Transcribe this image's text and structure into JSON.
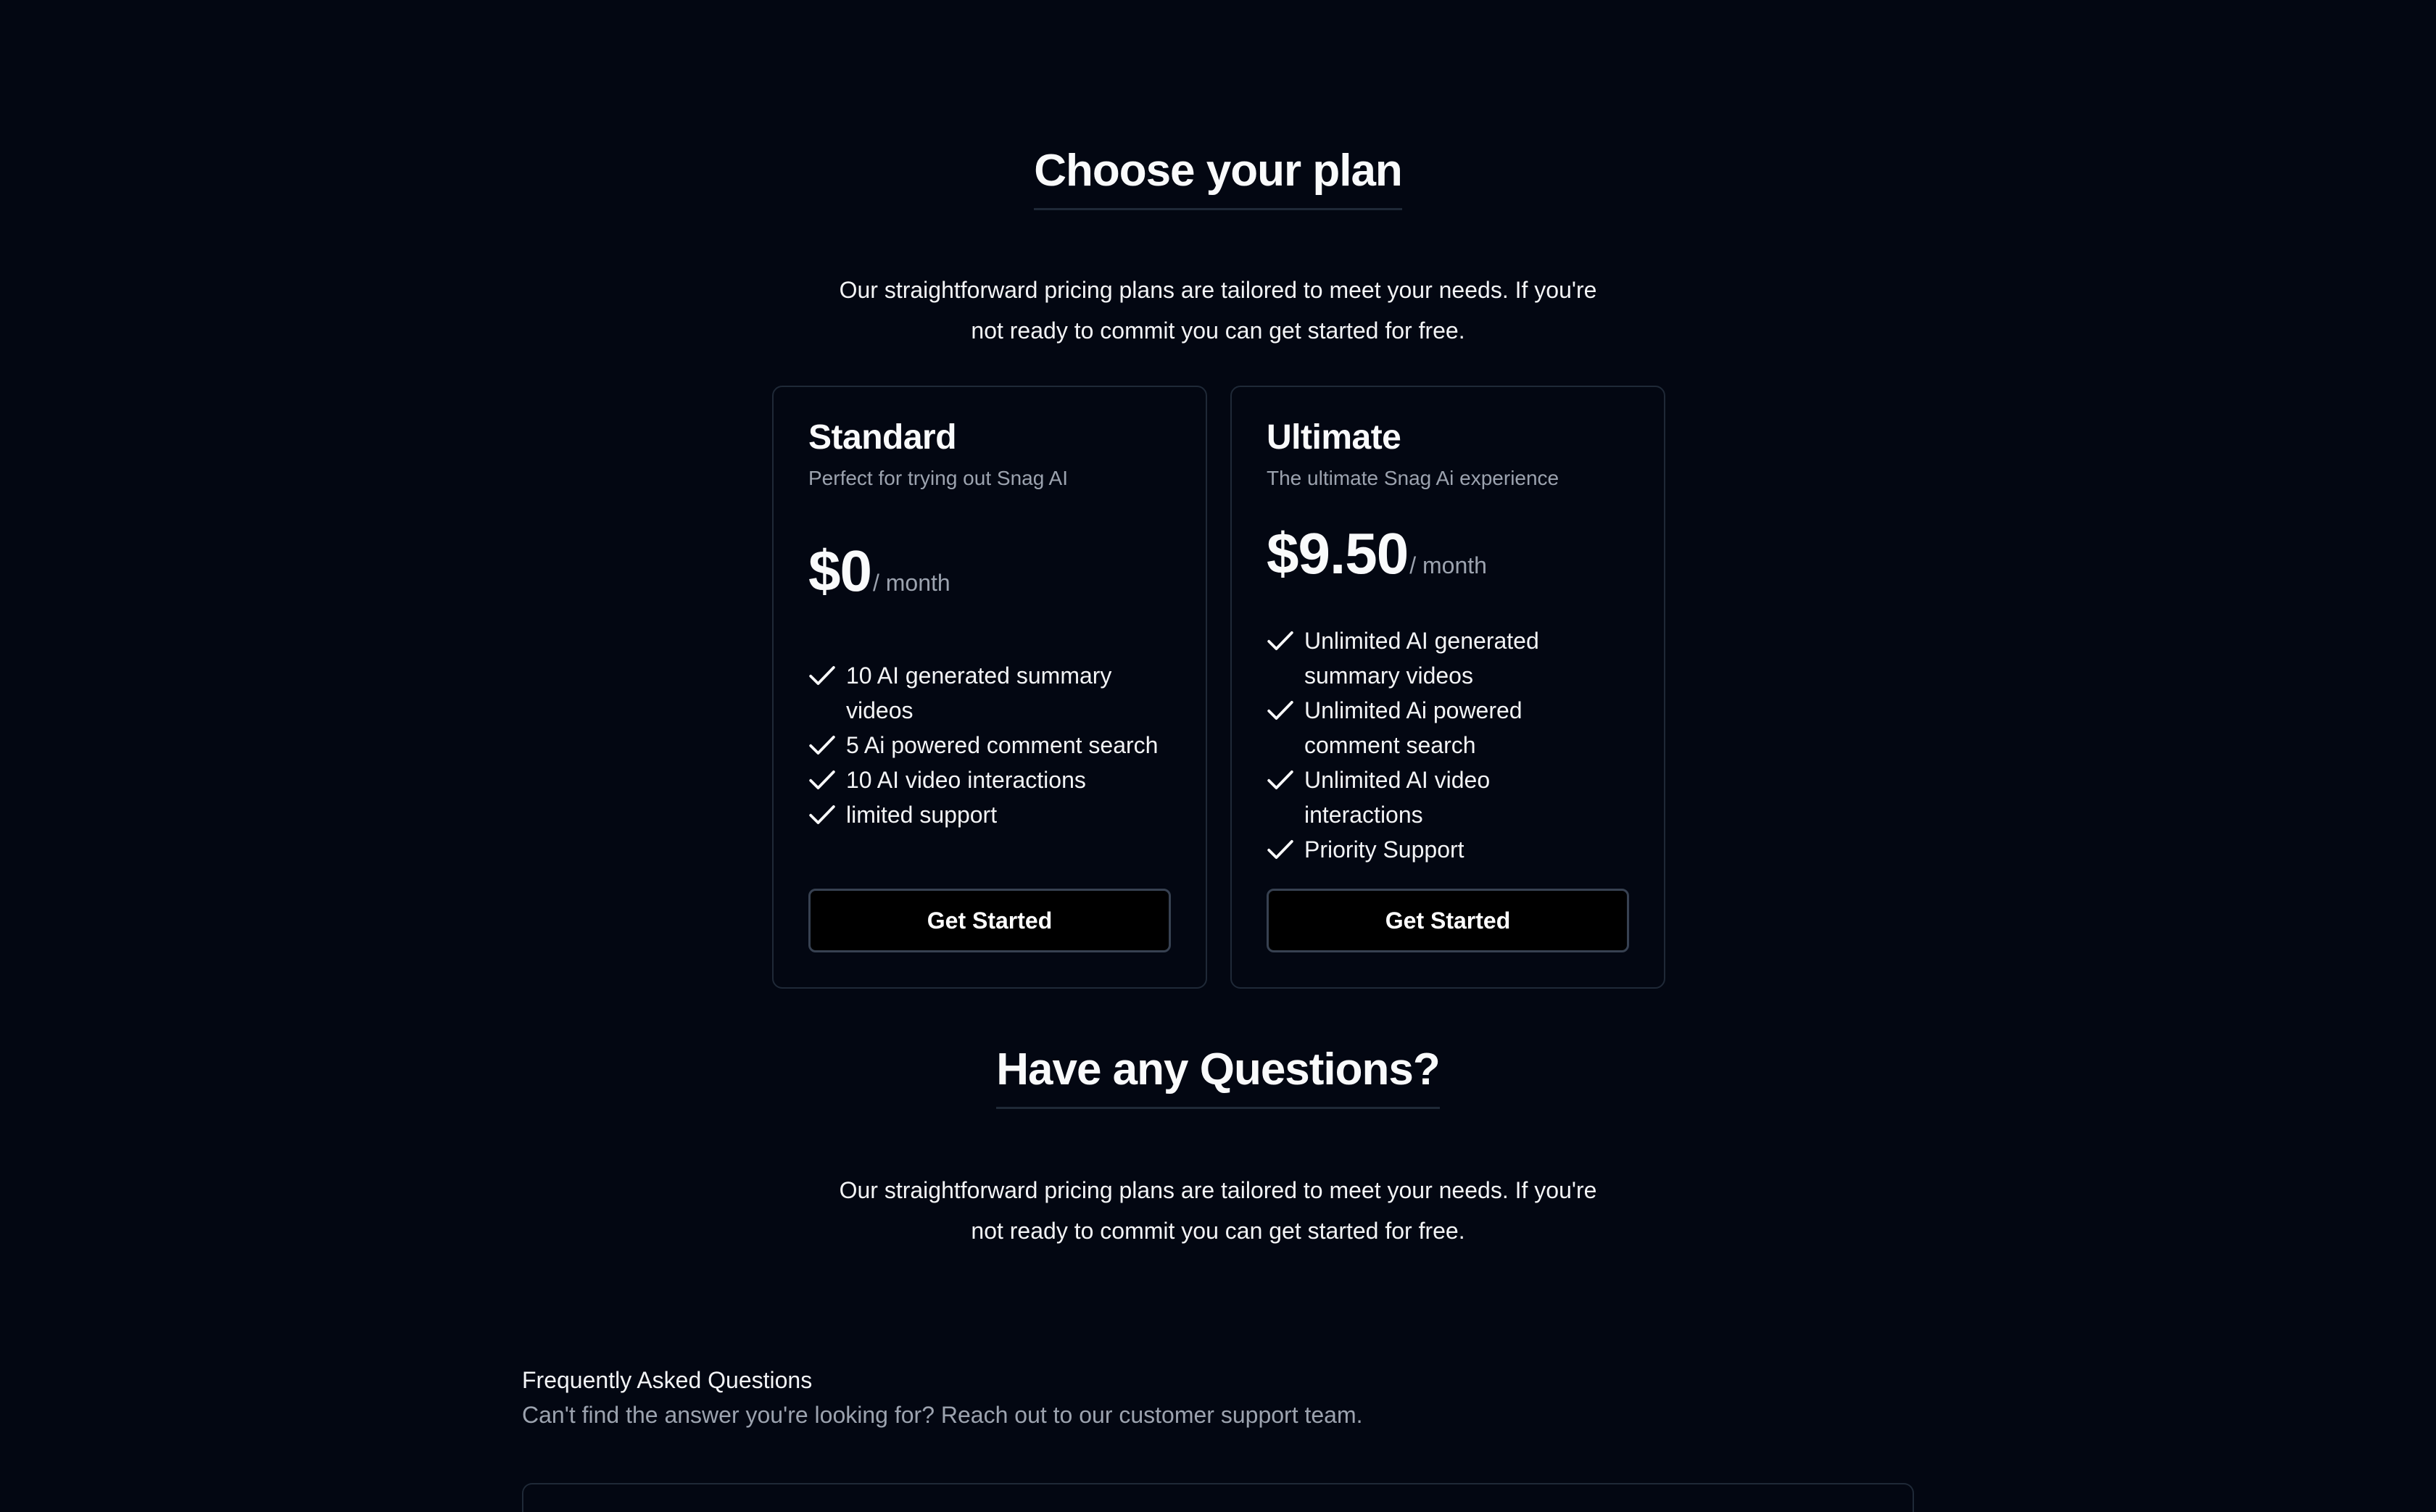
{
  "pricing": {
    "title": "Choose your plan",
    "intro": "Our straightforward pricing plans are tailored to meet your needs. If you're not ready to commit you can get started for free."
  },
  "plans": [
    {
      "name": "Standard",
      "description": "Perfect for trying out Snag AI",
      "price": "$0",
      "period": "/ month",
      "features": [
        "10 AI generated summary videos",
        "5 Ai powered comment search",
        "10 AI video interactions",
        "limited support"
      ],
      "cta": "Get Started"
    },
    {
      "name": "Ultimate",
      "description": "The ultimate Snag Ai experience",
      "price": "$9.50",
      "period": "/ month",
      "features": [
        "Unlimited AI generated summary videos",
        "Unlimited Ai powered comment search",
        "Unlimited AI video interactions",
        "Priority Support"
      ],
      "cta": "Get Started"
    }
  ],
  "questions": {
    "title": "Have any Questions?",
    "intro": "Our straightforward pricing plans are tailored to meet your needs. If you're not ready to commit you can get started for free."
  },
  "faq": {
    "title": "Frequently Asked Questions",
    "subtitle": "Can't find the answer you're looking for? Reach out to our customer support team."
  },
  "icons": {
    "feature": "check-icon"
  },
  "colors": {
    "background": "#030712",
    "text": "#f9fafb",
    "muted": "#9ca3af",
    "border": "#1f2937",
    "button": "#000000"
  }
}
